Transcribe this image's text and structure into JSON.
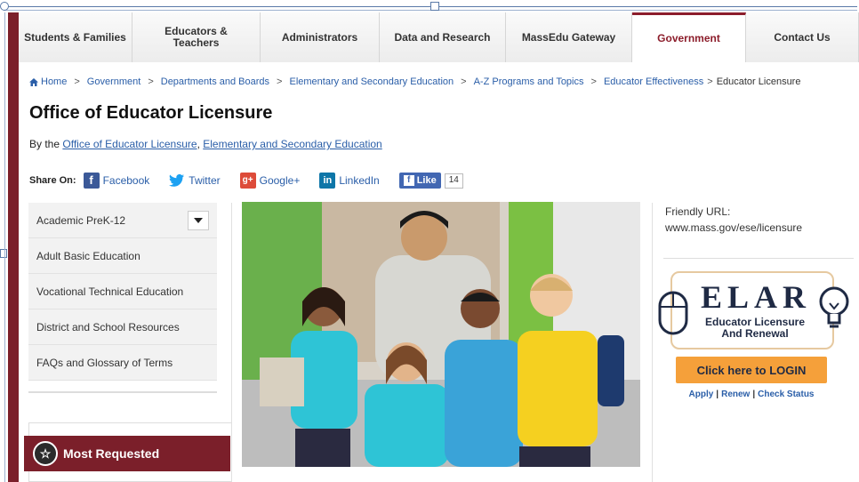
{
  "nav": {
    "items": [
      {
        "label": "Students & Families"
      },
      {
        "label": "Educators & Teachers"
      },
      {
        "label": "Administrators"
      },
      {
        "label": "Data and Research"
      },
      {
        "label": "MassEdu Gateway"
      },
      {
        "label": "Government"
      },
      {
        "label": "Contact Us"
      }
    ],
    "active": "Government"
  },
  "breadcrumb": [
    "Home",
    "Government",
    "Departments and Boards",
    "Elementary and Secondary Education",
    "A-Z Programs and Topics",
    "Educator Effectiveness",
    "Educator Licensure"
  ],
  "page": {
    "title": "Office of Educator Licensure",
    "by_prefix": "By the",
    "by_link1": "Office of Educator Licensure",
    "by_sep": ",",
    "by_link2": "Elementary and Secondary Education"
  },
  "share": {
    "label": "Share On:",
    "facebook": "Facebook",
    "twitter": "Twitter",
    "google": "Google+",
    "linkedin": "LinkedIn",
    "like": "Like",
    "like_count": "14"
  },
  "sidebar": {
    "items": [
      {
        "label": "Academic PreK-12"
      },
      {
        "label": "Adult Basic Education"
      },
      {
        "label": "Vocational Technical Education"
      },
      {
        "label": "District and School Resources"
      },
      {
        "label": "FAQs and Glossary of Terms"
      }
    ],
    "most_requested": "Most Requested"
  },
  "right": {
    "friendly_label": "Friendly URL:",
    "friendly_url": "www.mass.gov/ese/licensure",
    "elar_title": "ELAR",
    "elar_sub1": "Educator Licensure",
    "elar_sub2": "And Renewal",
    "login": "Click here to LOGIN",
    "apply": "Apply",
    "renew": "Renew",
    "check": "Check Status"
  },
  "colors": {
    "maroon": "#7b1f2a",
    "link": "#2a5ea8",
    "orange": "#f5a03a"
  }
}
